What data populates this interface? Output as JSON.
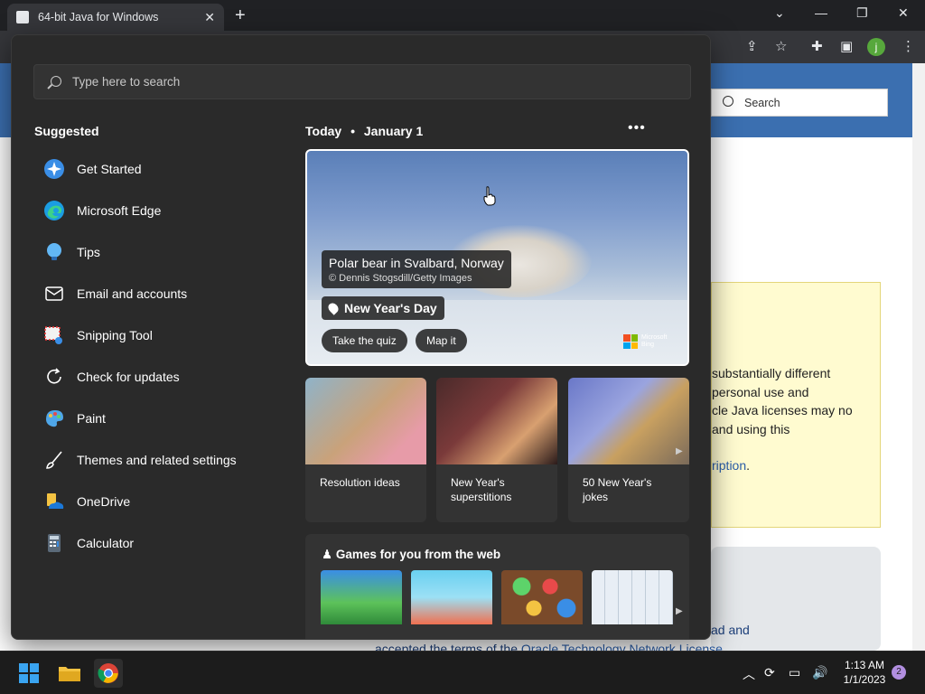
{
  "browser": {
    "tab_title": "64-bit Java for Windows",
    "tab_close": "✕",
    "new_tab": "+",
    "win_min": "—",
    "win_restore": "❐",
    "win_close": "✕",
    "chevron": "⌄",
    "profile_initial": "j"
  },
  "webpage": {
    "search_placeholder": "Search",
    "notice_lines": [
      "substantially different",
      "personal use and",
      "cle Java licenses may no",
      "and using this"
    ],
    "notice_link": "ription",
    "notice_link_suffix": ".",
    "bottom_line1": "ad and",
    "bottom_line2_prefix": "accepted the terms of the ",
    "bottom_line2_link": "Oracle Technology Network License"
  },
  "start_menu": {
    "search_placeholder": "Type here to search",
    "suggested_title": "Suggested",
    "suggested": [
      {
        "label": "Get Started",
        "icon": "get-started-icon"
      },
      {
        "label": "Microsoft Edge",
        "icon": "edge-icon"
      },
      {
        "label": "Tips",
        "icon": "tips-icon"
      },
      {
        "label": "Email and accounts",
        "icon": "mail-icon"
      },
      {
        "label": "Snipping Tool",
        "icon": "snipping-tool-icon"
      },
      {
        "label": "Check for updates",
        "icon": "refresh-icon"
      },
      {
        "label": "Paint",
        "icon": "paint-icon"
      },
      {
        "label": "Themes and related settings",
        "icon": "brush-icon"
      },
      {
        "label": "OneDrive",
        "icon": "onedrive-icon"
      },
      {
        "label": "Calculator",
        "icon": "calculator-icon"
      }
    ],
    "today_label": "Today",
    "today_sep": "•",
    "today_date": "January 1",
    "more": "•••",
    "hero": {
      "title": "Polar bear in Svalbard, Norway",
      "credit": "© Dennis Stogsdill/Getty Images",
      "event": "New Year's Day",
      "quiz_button": "Take the quiz",
      "map_button": "Map it",
      "brand_line1": "Microsoft",
      "brand_line2": "Bing"
    },
    "cards": [
      {
        "label": "Resolution ideas"
      },
      {
        "label": "New Year's superstitions"
      },
      {
        "label": "50 New Year's jokes"
      }
    ],
    "games_title": "Games for you from the web",
    "arrow": "▶"
  },
  "taskbar": {
    "time": "1:13 AM",
    "date": "1/1/2023",
    "notifications": "2",
    "tray_chevron": "︿"
  }
}
